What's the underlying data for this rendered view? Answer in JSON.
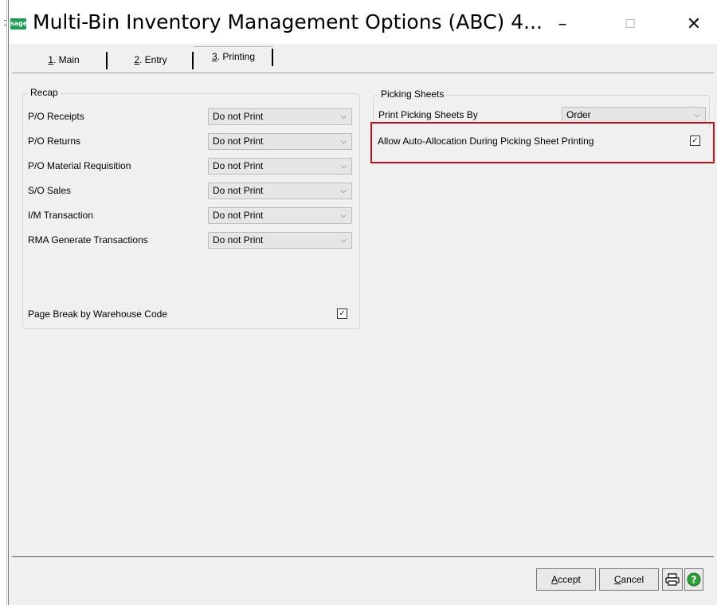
{
  "window": {
    "title": "Multi-Bin Inventory Management Options (ABC) 4...",
    "app_icon_text": "sage",
    "controls": {
      "minimize": "–",
      "maximize": "☐",
      "close": "✕"
    }
  },
  "tabs": [
    {
      "key": "1",
      "label": ". Main",
      "active": false
    },
    {
      "key": "2",
      "label": ". Entry",
      "active": false
    },
    {
      "key": "3",
      "label": ". Printing",
      "active": true
    }
  ],
  "recap": {
    "title": "Recap",
    "rows": [
      {
        "label": "P/O Receipts",
        "value": "Do not Print"
      },
      {
        "label": "P/O Returns",
        "value": "Do not Print"
      },
      {
        "label": "P/O Material Requisition",
        "value": "Do not Print"
      },
      {
        "label": "S/O Sales",
        "value": "Do not Print"
      },
      {
        "label": "I/M Transaction",
        "value": "Do not Print"
      },
      {
        "label": "RMA Generate Transactions",
        "value": "Do not Print"
      }
    ],
    "page_break_label": "Page Break by Warehouse Code",
    "page_break_checked": true
  },
  "picking": {
    "title": "Picking Sheets",
    "print_by_label": "Print Picking Sheets By",
    "print_by_value": "Order",
    "auto_alloc_label": "Allow Auto-Allocation During Picking Sheet Printing",
    "auto_alloc_checked": true
  },
  "footer": {
    "accept_key": "A",
    "accept_rest": "ccept",
    "cancel_key": "C",
    "cancel_rest": "ancel"
  },
  "colors": {
    "highlight": "#b8141b",
    "sage_green": "#1f9d55",
    "help_green": "#2e9e3a"
  },
  "icons": [
    "printer-icon",
    "help-icon",
    "chevron-down-icon",
    "checkmark-icon"
  ]
}
